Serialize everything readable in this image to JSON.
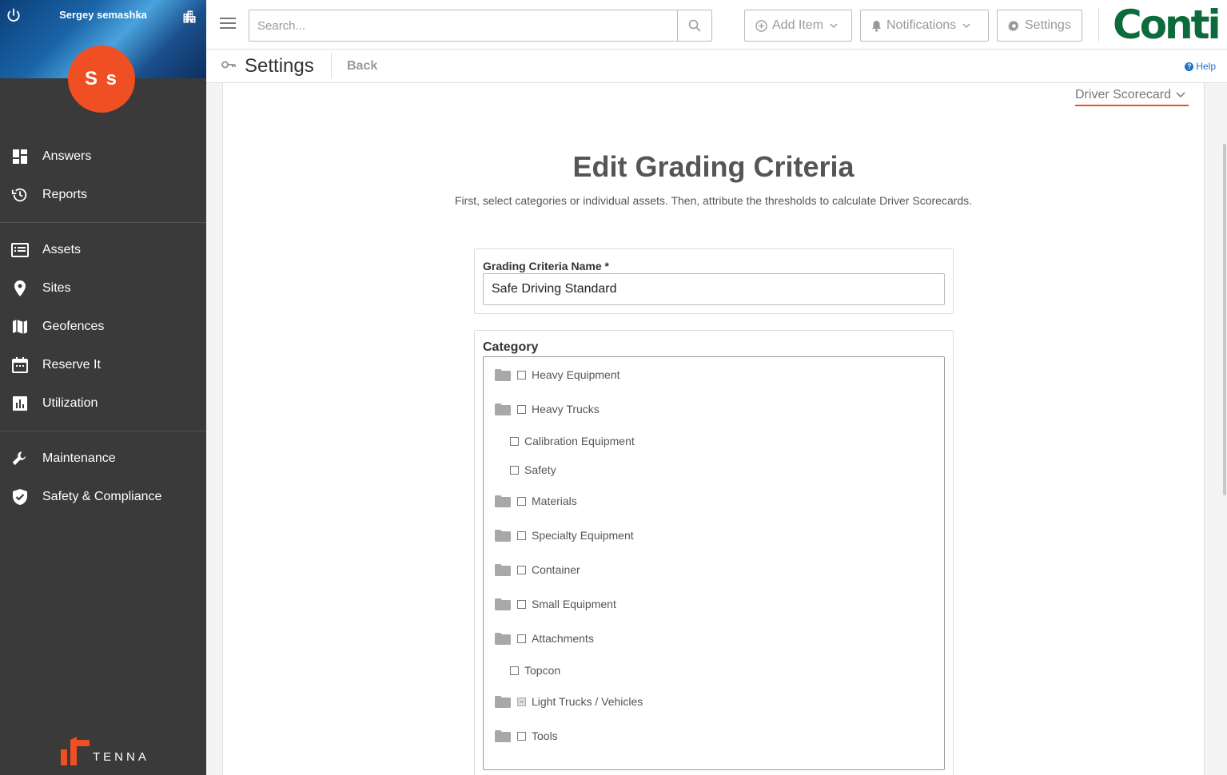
{
  "sidebar": {
    "user_name": "Sergey semashka",
    "avatar_initials": "S s",
    "avatar_color": "#f04e23",
    "groups": [
      [
        {
          "label": "Answers",
          "icon": "dashboard-icon"
        },
        {
          "label": "Reports",
          "icon": "history-icon"
        }
      ],
      [
        {
          "label": "Assets",
          "icon": "list-icon"
        },
        {
          "label": "Sites",
          "icon": "location-pin-icon"
        },
        {
          "label": "Geofences",
          "icon": "map-icon"
        },
        {
          "label": "Reserve It",
          "icon": "calendar-icon"
        },
        {
          "label": "Utilization",
          "icon": "bar-chart-icon"
        }
      ],
      [
        {
          "label": "Maintenance",
          "icon": "wrench-icon"
        },
        {
          "label": "Safety & Compliance",
          "icon": "shield-check-icon"
        }
      ]
    ],
    "logo_text": "TENNA"
  },
  "topbar": {
    "search_placeholder": "Search...",
    "add_item_label": "Add Item",
    "notifications_label": "Notifications",
    "settings_label": "Settings",
    "brand_logo": "Conti",
    "brand_color": "#0d6b3b"
  },
  "subheader": {
    "title": "Settings",
    "back_label": "Back",
    "help_label": "Help"
  },
  "main": {
    "scorecard_select": "Driver Scorecard",
    "heading": "Edit Grading Criteria",
    "subheading": "First, select categories or individual assets. Then, attribute the thresholds to calculate Driver Scorecards.",
    "name_label": "Grading Criteria Name *",
    "name_value": "Safe Driving Standard",
    "category_label": "Category",
    "categories": [
      {
        "label": "Heavy Equipment",
        "folder": true,
        "state": "unchecked"
      },
      {
        "label": "Heavy Trucks",
        "folder": true,
        "state": "unchecked"
      },
      {
        "label": "Calibration Equipment",
        "folder": false,
        "state": "unchecked"
      },
      {
        "label": "Safety",
        "folder": false,
        "state": "unchecked"
      },
      {
        "label": "Materials",
        "folder": true,
        "state": "unchecked"
      },
      {
        "label": "Specialty Equipment",
        "folder": true,
        "state": "unchecked"
      },
      {
        "label": "Container",
        "folder": true,
        "state": "unchecked"
      },
      {
        "label": "Small Equipment",
        "folder": true,
        "state": "unchecked"
      },
      {
        "label": "Attachments",
        "folder": true,
        "state": "unchecked"
      },
      {
        "label": "Topcon",
        "folder": false,
        "state": "unchecked"
      },
      {
        "label": "Light Trucks / Vehicles",
        "folder": true,
        "state": "partial"
      },
      {
        "label": "Tools",
        "folder": true,
        "state": "unchecked"
      }
    ]
  }
}
